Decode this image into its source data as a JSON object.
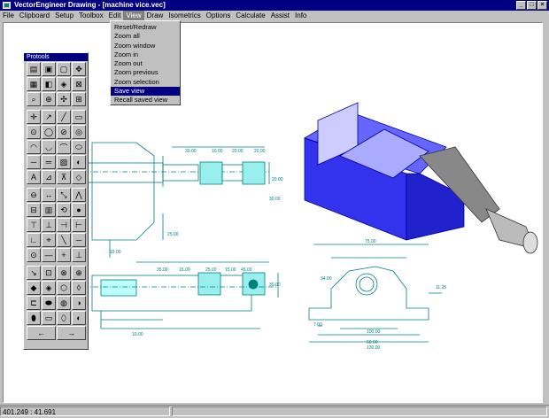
{
  "window": {
    "title": "VectorEngineer Drawing - [machine vice.vec]"
  },
  "menubar": {
    "items": [
      "File",
      "Clipboard",
      "Setup",
      "Toolbox",
      "Edit",
      "View",
      "Draw",
      "Isometrics",
      "Options",
      "Calculate",
      "Assist",
      "Info"
    ],
    "active_index": 5
  },
  "view_menu": {
    "items": [
      "Reset/Redraw",
      "Zoom all",
      "Zoom window",
      "Zoom in",
      "Zoom out",
      "Zoom previous",
      "Zoom selection",
      "Save view",
      "Recall saved view"
    ],
    "selected_index": 7
  },
  "palette": {
    "title": "Protools"
  },
  "dimensions": {
    "top_view": [
      "30.00",
      "10.00",
      "20.00",
      "20.00",
      "20.00",
      "30.00",
      "25.00",
      "15.00",
      "25.00"
    ],
    "front_view": [
      "35.00",
      "15.00",
      "25.00",
      "15.00",
      "45.00",
      "30.00",
      "20.00",
      "10.00"
    ],
    "end_view": [
      "75.00",
      "34.00",
      "60.00",
      "100.00",
      "130.00",
      "7.00",
      "11.25"
    ]
  },
  "status": {
    "coords": "401.249 : 41.691"
  },
  "colors": {
    "title": "#000080",
    "drawing": "#008080",
    "vice_blue": "#3333ee",
    "menu_sel": "#000080"
  }
}
